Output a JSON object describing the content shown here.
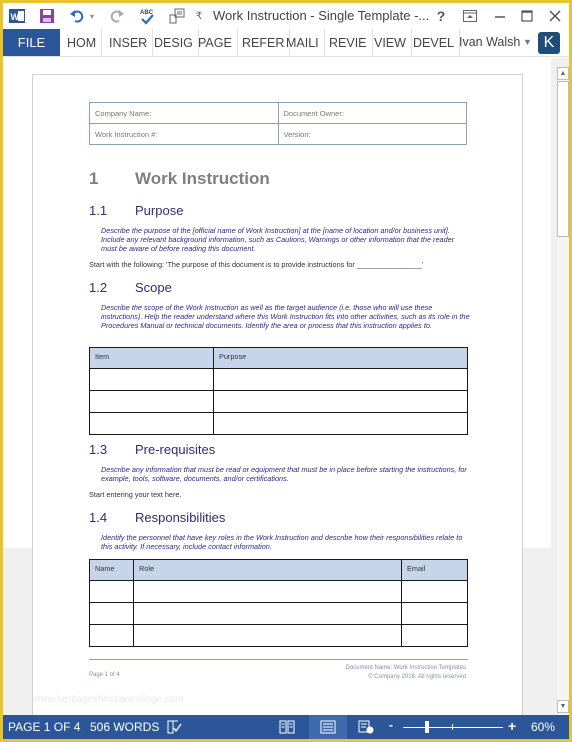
{
  "titlebar": {
    "title": "Work Instruction - Single Template -...",
    "help": "?",
    "icons": [
      "word-app-icon",
      "save-icon",
      "undo-icon",
      "redo-icon",
      "spelling-icon",
      "touch-mode-icon",
      "customize-qat-icon"
    ]
  },
  "ribbon": {
    "file_label": "FILE",
    "tabs": [
      "HOM",
      "INSER",
      "DESIG",
      "PAGE",
      "REFER",
      "MAILI",
      "REVIE",
      "VIEW",
      "DEVEL"
    ],
    "user_name": "Ivan Walsh",
    "avatar_letter": "K"
  },
  "document": {
    "header_table": {
      "company_name": "Company Name:",
      "document_owner": "Document Owner:",
      "work_instruction_no": "Work Instruction #:",
      "version": "Version:"
    },
    "heading1": {
      "number": "1",
      "text": "Work Instruction"
    },
    "sections": [
      {
        "number": "1.1",
        "title": "Purpose",
        "guidance": "Describe the purpose of the [official name of Work Instruction] at the [name of location and/or business unit]. Include any relevant background information, such as Cautions, Warnings or other information that the reader must be aware of before reading this document.",
        "body": "Start with the following: 'The purpose of this document is to provide instructions for ________________'"
      },
      {
        "number": "1.2",
        "title": "Scope",
        "guidance": "Describe the scope of the Work Instruction as well as the target audience (i.e. those who will use these instructions). Help the reader understand where this Work Instruction fits into other activities, such as its role in the Procedures Manual or technical documents. Identify the area or process that this instruction applies to.",
        "table": {
          "headers": [
            "Item",
            "Purpose"
          ],
          "rows": [
            [
              "",
              ""
            ],
            [
              "",
              ""
            ],
            [
              "",
              ""
            ]
          ]
        }
      },
      {
        "number": "1.3",
        "title": "Pre-requisites",
        "guidance": "Describe any information that must be read or equipment that must be in place before starting the instructions, for example, tools, software, documents, and/or certifications.",
        "body": "Start entering your text here."
      },
      {
        "number": "1.4",
        "title": "Responsibilities",
        "guidance": "Identify the personnel that have key roles in the Work Instruction and describe how their responsibilities relate to this activity. If necessary, include contact information.",
        "table": {
          "headers": [
            "Name",
            "Role",
            "Email"
          ],
          "rows": [
            [
              "",
              "",
              ""
            ],
            [
              "",
              "",
              ""
            ],
            [
              "",
              "",
              ""
            ]
          ]
        }
      }
    ],
    "footer": {
      "page": "Page 1 of 4",
      "doc_name": "Document Name: Work Instruction Templates",
      "copyright": "© Company 2016. All rights reserved"
    },
    "watermark": "www.heritagechristiancollege.com"
  },
  "statusbar": {
    "page": "PAGE 1 OF 4",
    "words": "506 WORDS",
    "zoom_minus": "-",
    "zoom_plus": "+",
    "zoom_level": "60%",
    "zoom_percent": 60
  },
  "colors": {
    "accent": "#2b579a",
    "heading2": "#2e2d72",
    "table_header": "#c6d5ea",
    "frame": "#e6c52e"
  }
}
